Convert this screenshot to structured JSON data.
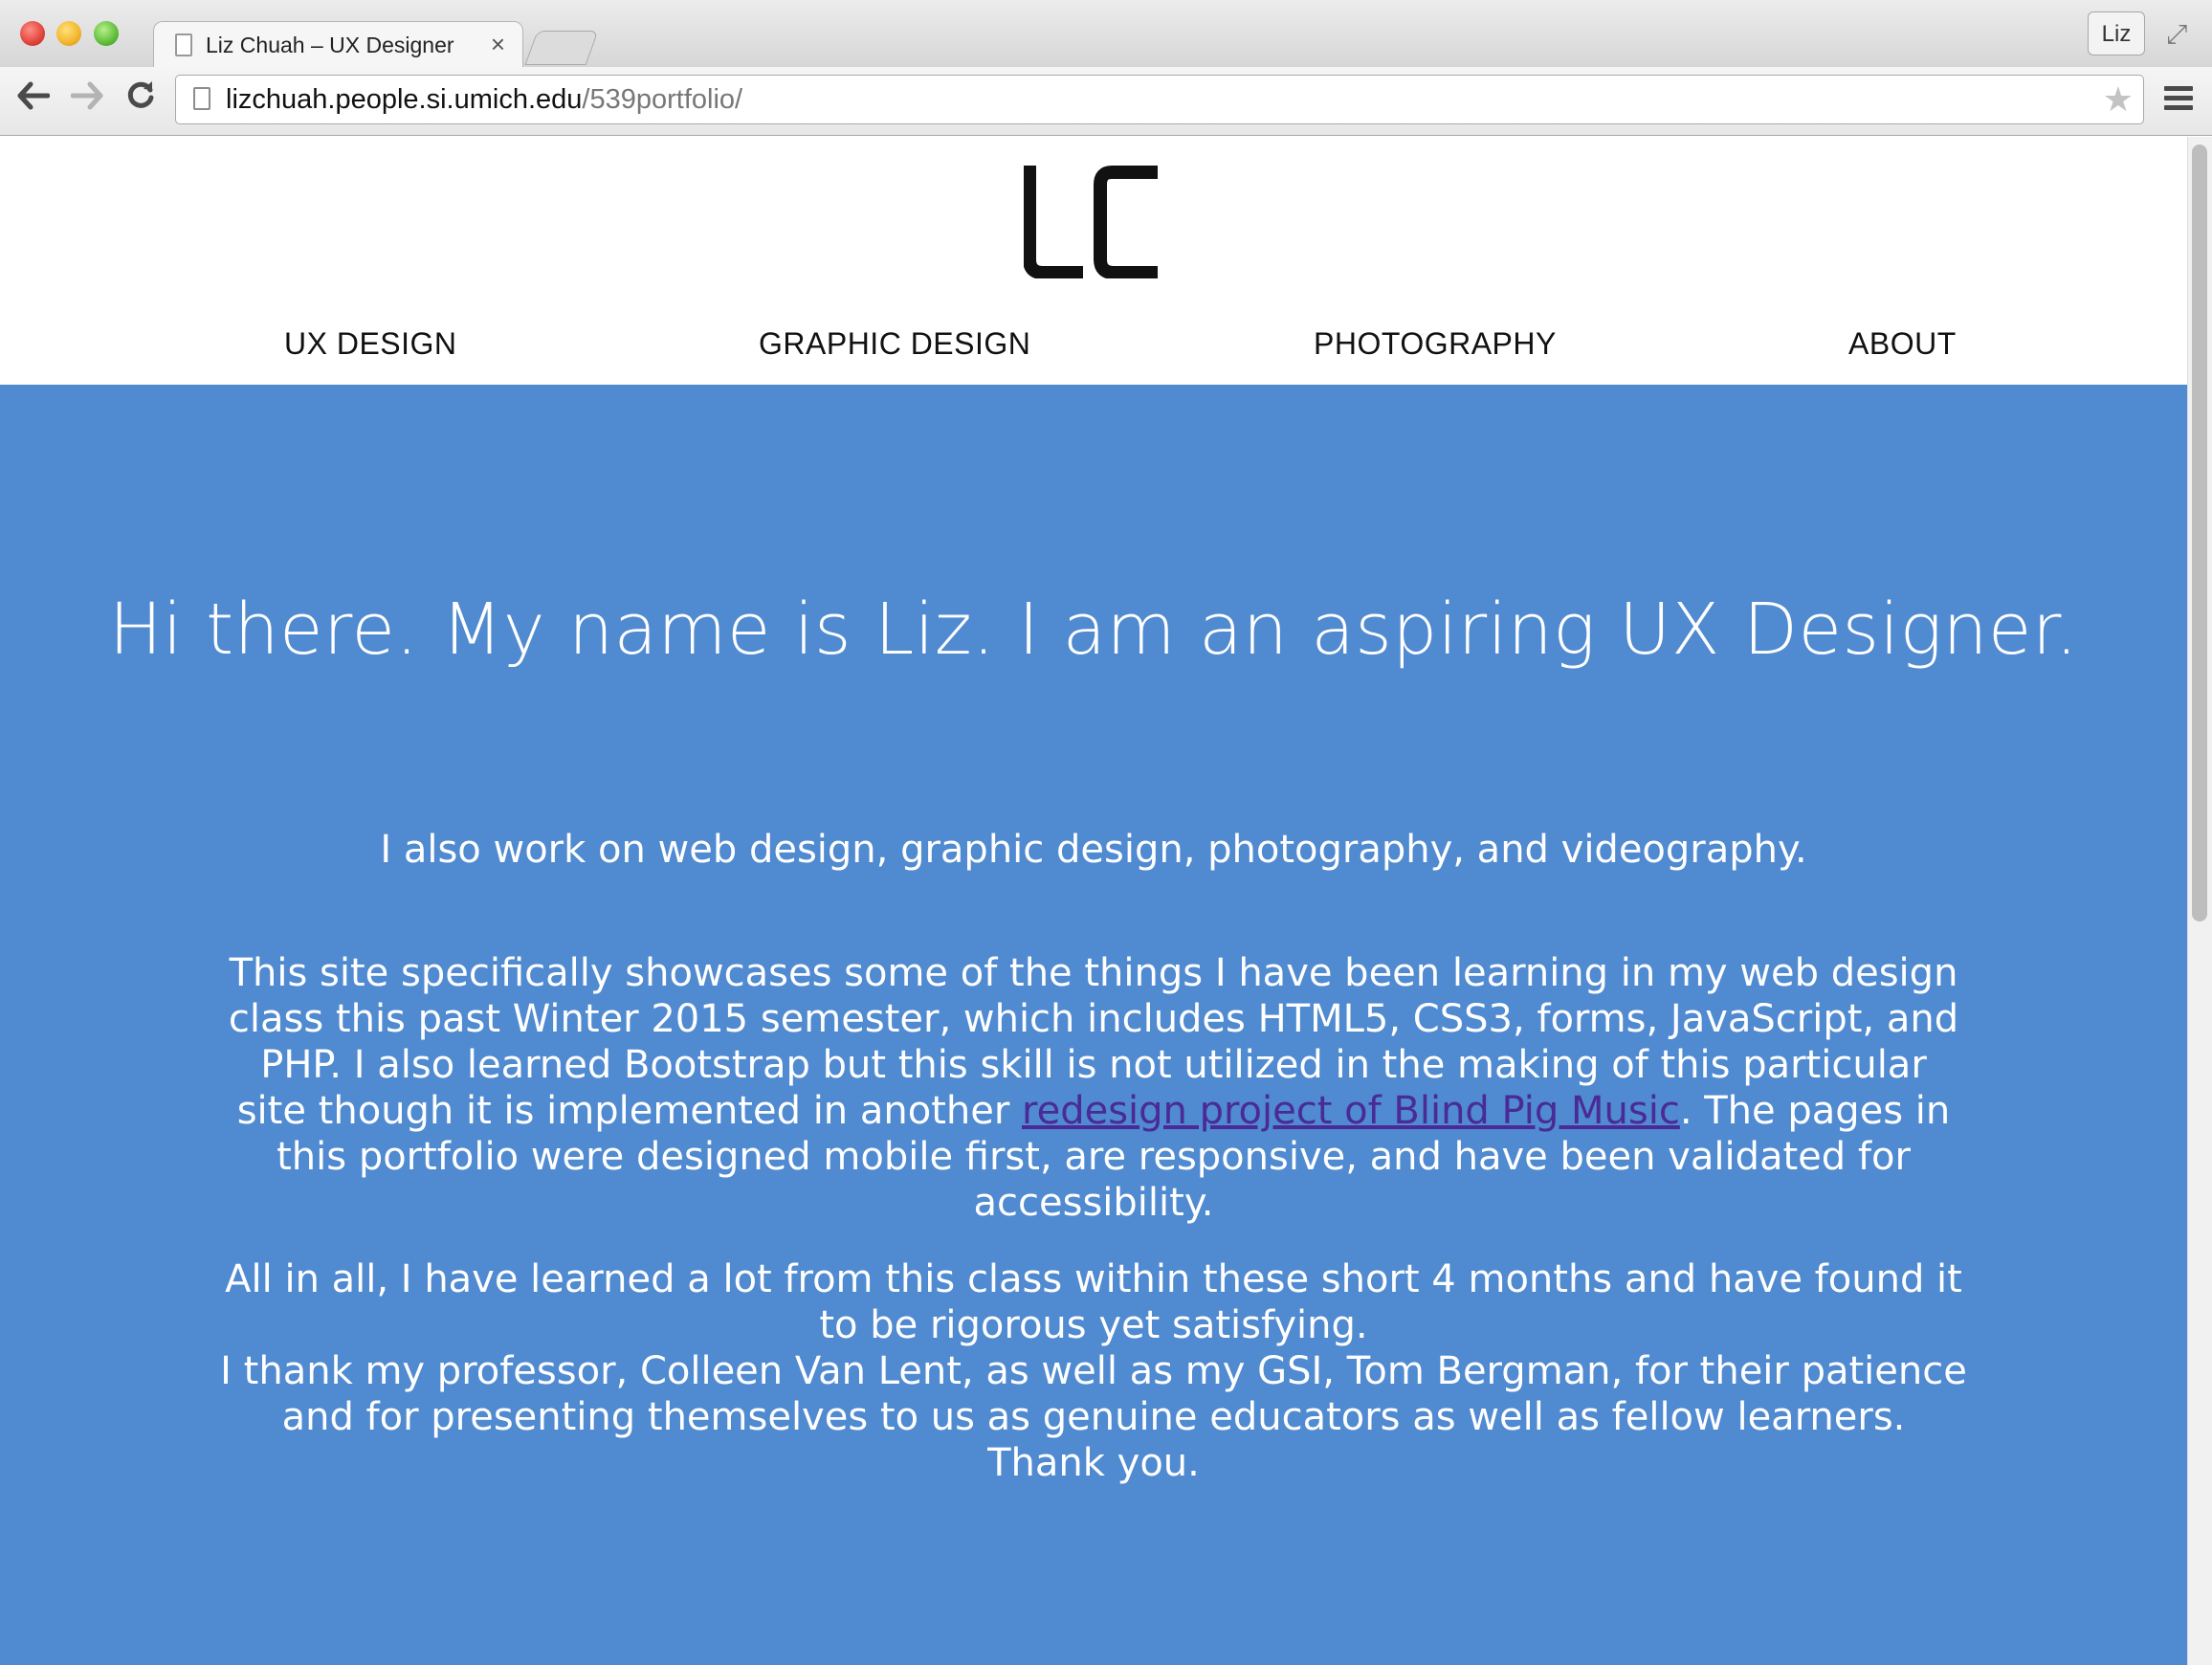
{
  "browser": {
    "tab_title": "Liz Chuah – UX Designer",
    "tab_close": "×",
    "profile_label": "Liz",
    "url_host": "lizchuah.people.si.umich.edu",
    "url_path": "/539portfolio/",
    "icons": [
      "back-arrow-icon",
      "forward-arrow-icon",
      "reload-icon",
      "page-icon",
      "star-icon",
      "menu-icon",
      "fullscreen-icon"
    ]
  },
  "site": {
    "logo_text": "LC",
    "nav": [
      "UX DESIGN",
      "GRAPHIC DESIGN",
      "PHOTOGRAPHY",
      "ABOUT"
    ],
    "headline": "Hi there. My name is Liz. I am an aspiring UX Designer.",
    "para1": "I also work on web design, graphic design, photography, and videography.",
    "para2_before": "This site specifically showcases some of the things I have been learning in my web design class this past Winter 2015 semester, which includes HTML5, CSS3, forms, JavaScript, and PHP. I also learned Bootstrap but this skill is not utilized in the making of this particular site though it is implemented in another ",
    "para2_link": "redesign project of Blind Pig Music",
    "para2_after": ". The pages in this portfolio were designed mobile first, are responsive, and have been validated for accessibility.",
    "para3_line1": "All in all, I have learned a lot from this class within these short 4 months and have found it to be rigorous yet satisfying.",
    "para3_line2": "I thank my professor, Colleen Van Lent, as well as my GSI, Tom Bergman, for their patience and for presenting themselves to us as genuine educators as well as fellow learners.",
    "para3_line3": "Thank you."
  },
  "colors": {
    "hero_background": "#508ad0",
    "link": "#4a2a96"
  }
}
